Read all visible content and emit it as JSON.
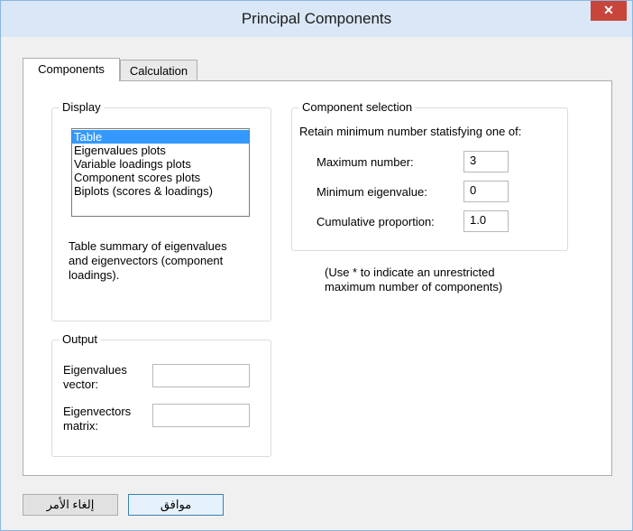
{
  "window": {
    "title": "Principal Components",
    "close_glyph": "✕"
  },
  "tabs": [
    {
      "label": "Components",
      "active": true
    },
    {
      "label": "Calculation",
      "active": false
    }
  ],
  "display": {
    "title": "Display",
    "items": [
      "Table",
      "Eigenvalues plots",
      "Variable loadings plots",
      "Component scores plots",
      "Biplots (scores & loadings)"
    ],
    "selected": "Table",
    "description_line1": "Table summary of eigenvalues",
    "description_line2": "and eigenvectors (component",
    "description_line3": "loadings)."
  },
  "component_selection": {
    "title": "Component selection",
    "retain_text": "Retain minimum number statisfying one of:",
    "max_label": "Maximum number:",
    "max_value": "3",
    "min_eig_label": "Minimum eigenvalue:",
    "min_eig_value": "0",
    "cum_label": "Cumulative proportion:",
    "cum_value": "1.0",
    "note_line1": "(Use * to indicate an unrestricted",
    "note_line2": "maximum number of components)"
  },
  "output": {
    "title": "Output",
    "eigenvalues_label_line1": "Eigenvalues",
    "eigenvalues_label_line2": "vector:",
    "eigenvalues_value": "",
    "eigenvectors_label_line1": "Eigenvectors",
    "eigenvectors_label_line2": "matrix:",
    "eigenvectors_value": ""
  },
  "buttons": {
    "cancel": "إلغاء الأمر",
    "ok": "موافق"
  },
  "colors": {
    "selection": "#3399ff",
    "close_button": "#c7453b",
    "titlebar": "#d9e7f6"
  }
}
